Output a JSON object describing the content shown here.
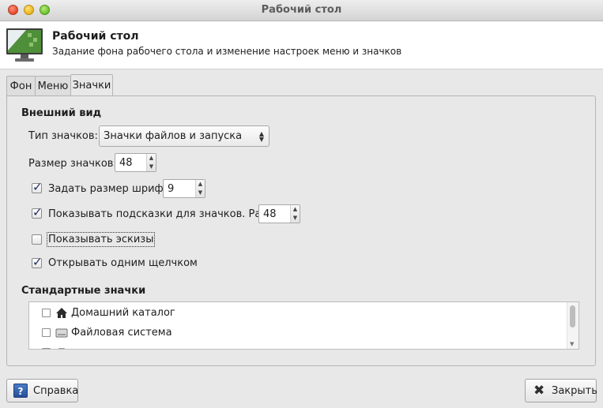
{
  "window": {
    "title": "Рабочий стол"
  },
  "header": {
    "title": "Рабочий стол",
    "subtitle": "Задание фона рабочего стола и изменение настроек меню и значков",
    "icon": "desktop-monitor-icon"
  },
  "tabs": [
    {
      "label": "Фон",
      "active": false
    },
    {
      "label": "Меню",
      "active": false
    },
    {
      "label": "Значки",
      "active": true
    }
  ],
  "appearance": {
    "section_title": "Внешний вид",
    "icon_type_label": "Тип значков:",
    "icon_type_value": "Значки файлов и запуска",
    "icon_size_label": "Размер значков:",
    "icon_size_value": "48",
    "font_size": {
      "label": "Задать размер шрифта:",
      "checked": true,
      "value": "9"
    },
    "tooltips": {
      "label": "Показывать подсказки для значков. Размер:",
      "checked": true,
      "value": "48"
    },
    "thumbnails": {
      "label": "Показывать эскизы",
      "checked": false
    },
    "single_click": {
      "label": "Открывать одним щелчком",
      "checked": true
    }
  },
  "standard_icons": {
    "section_title": "Стандартные значки",
    "items": [
      {
        "label": "Домашний каталог",
        "icon": "home-icon",
        "checked": false
      },
      {
        "label": "Файловая система",
        "icon": "drive-icon",
        "checked": false
      }
    ]
  },
  "buttons": {
    "help": {
      "label": "Справка",
      "icon": "help-icon"
    },
    "close": {
      "label": "Закрыть",
      "icon": "close-icon"
    }
  },
  "colors": {
    "check_mark": "#1d2f63",
    "help_icon": "#2e5aa6"
  }
}
